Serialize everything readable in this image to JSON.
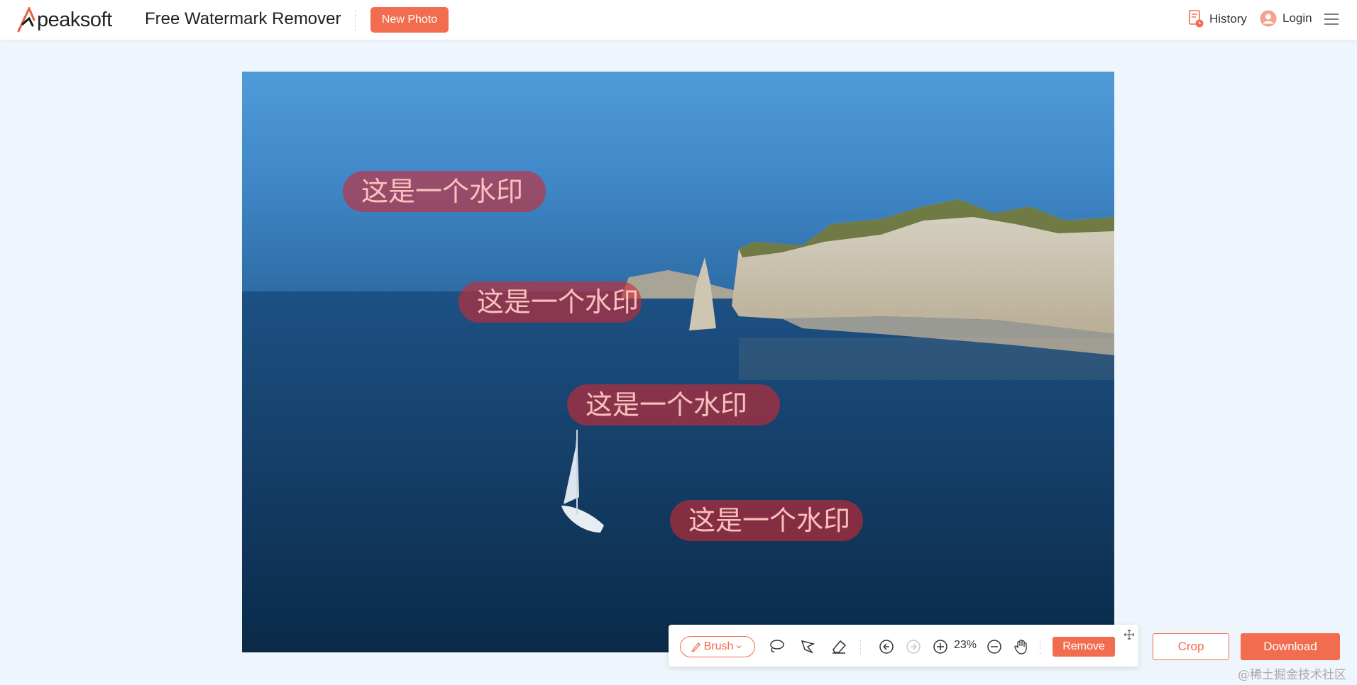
{
  "header": {
    "logo_text": "peaksoft",
    "app_title": "Free Watermark Remover",
    "new_photo_label": "New Photo",
    "history_label": "History",
    "login_label": "Login"
  },
  "canvas": {
    "watermarks": [
      {
        "text": "这是一个水印"
      },
      {
        "text": "这是一个水印"
      },
      {
        "text": "这是一个水印"
      },
      {
        "text": "这是一个水印"
      }
    ]
  },
  "toolbar": {
    "brush_label": "Brush",
    "zoom_level": "23%",
    "remove_label": "Remove"
  },
  "actions": {
    "crop_label": "Crop",
    "download_label": "Download"
  },
  "credit": "@稀土掘金技术社区",
  "colors": {
    "accent": "#f26c4f",
    "page_bg": "#eef5fc"
  }
}
